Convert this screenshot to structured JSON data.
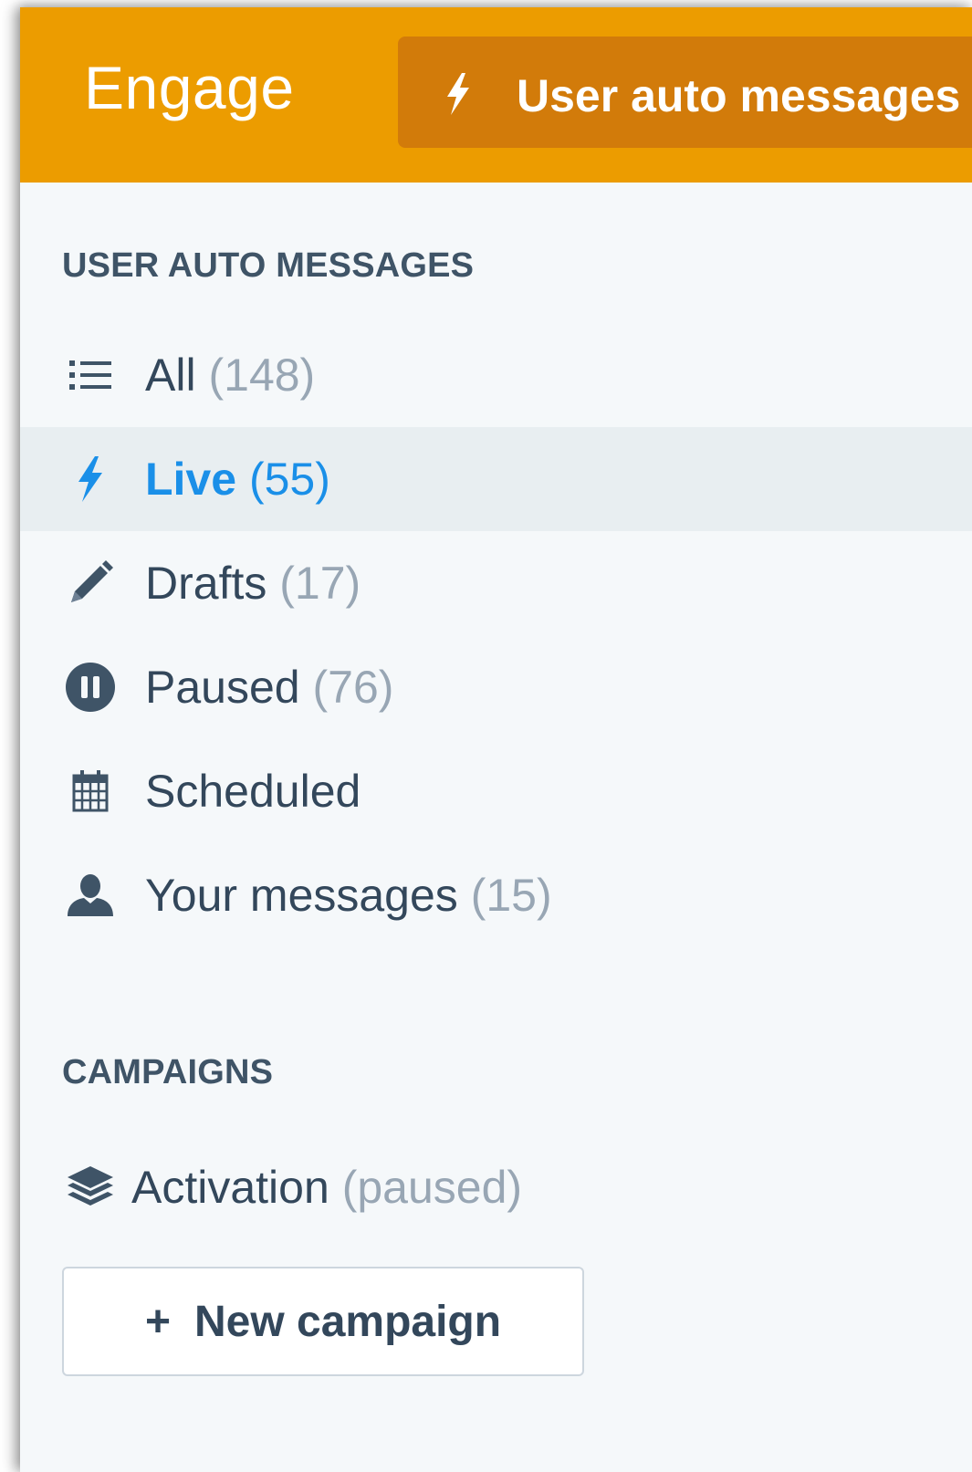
{
  "header": {
    "app_title": "Engage",
    "active_tab_label": "User auto messages"
  },
  "sidebar": {
    "section_title": "USER AUTO MESSAGES",
    "items": [
      {
        "label": "All",
        "count": "(148)",
        "icon": "list-icon"
      },
      {
        "label": "Live",
        "count": "(55)",
        "icon": "bolt-icon",
        "active": true
      },
      {
        "label": "Drafts",
        "count": "(17)",
        "icon": "pencil-icon"
      },
      {
        "label": "Paused",
        "count": "(76)",
        "icon": "pause-icon"
      },
      {
        "label": "Scheduled",
        "count": "",
        "icon": "calendar-icon"
      },
      {
        "label": "Your messages",
        "count": "(15)",
        "icon": "user-icon"
      }
    ]
  },
  "campaigns": {
    "section_title": "CAMPAIGNS",
    "items": [
      {
        "label": "Activation",
        "status": "(paused)",
        "icon": "layers-icon"
      }
    ],
    "new_button_label": "New campaign",
    "new_button_icon": "plus-icon"
  },
  "colors": {
    "header_bg": "#ec9c00",
    "tab_bg": "#d27b0a",
    "active_text": "#1a8fe8",
    "sidebar_bg": "#f5f8fa",
    "active_row_bg": "#e8eef1"
  }
}
